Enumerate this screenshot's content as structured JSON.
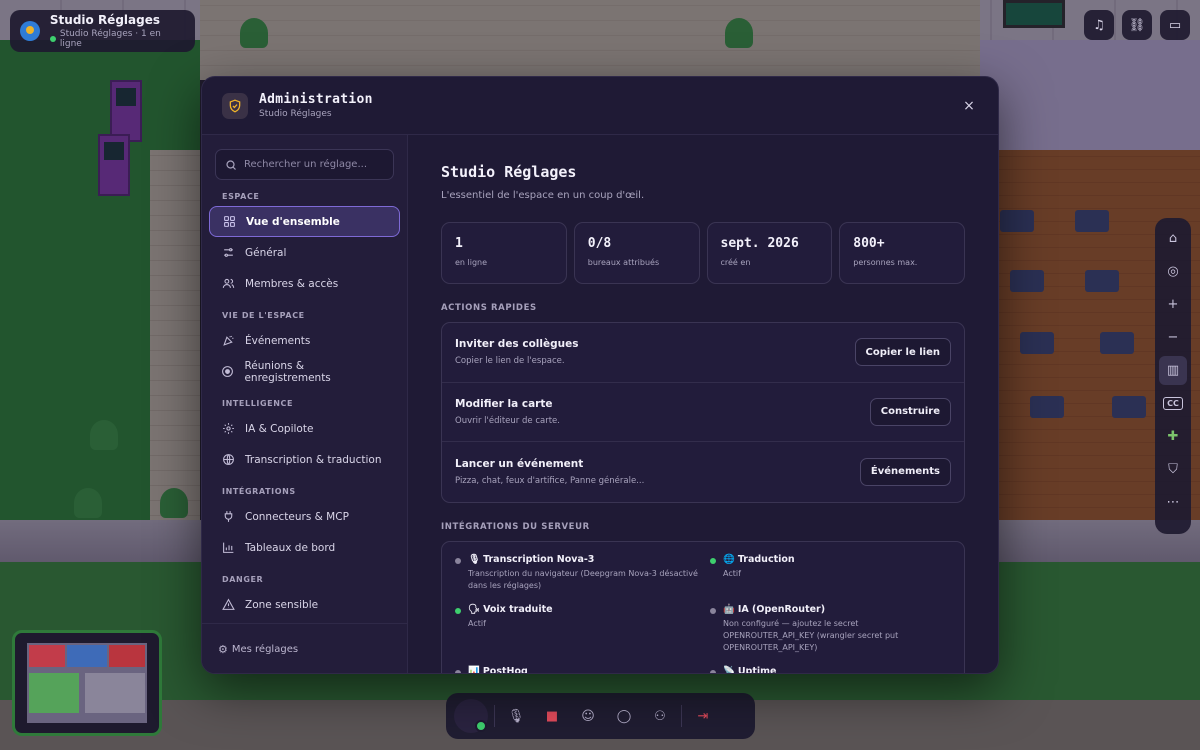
{
  "space": {
    "name": "Studio Réglages",
    "subtitle": "Studio Réglages · 1 en ligne"
  },
  "modal": {
    "title": "Administration",
    "subtitle": "Studio Réglages",
    "close_icon": "×"
  },
  "sidebar": {
    "search_placeholder": "Rechercher un réglage...",
    "sections": [
      {
        "title": "ESPACE",
        "items": [
          {
            "label": "Vue d'ensemble",
            "icon": "grid-icon",
            "active": true
          },
          {
            "label": "Général",
            "icon": "sliders-icon"
          },
          {
            "label": "Membres & accès",
            "icon": "users-icon"
          }
        ]
      },
      {
        "title": "VIE DE L'ESPACE",
        "items": [
          {
            "label": "Événements",
            "icon": "party-icon"
          },
          {
            "label": "Réunions & enregistrements",
            "icon": "record-icon"
          }
        ]
      },
      {
        "title": "INTELLIGENCE",
        "items": [
          {
            "label": "IA & Copilote",
            "icon": "gear-icon"
          },
          {
            "label": "Transcription & traduction",
            "icon": "globe-icon"
          }
        ]
      },
      {
        "title": "INTÉGRATIONS",
        "items": [
          {
            "label": "Connecteurs & MCP",
            "icon": "plug-icon"
          },
          {
            "label": "Tableaux de bord",
            "icon": "chart-icon"
          }
        ]
      },
      {
        "title": "DANGER",
        "items": [
          {
            "label": "Zone sensible",
            "icon": "warning-icon"
          }
        ]
      }
    ],
    "footer_label": "Mes réglages"
  },
  "main": {
    "title": "Studio Réglages",
    "lead": "L'essentiel de l'espace en un coup d'œil.",
    "stats": [
      {
        "value": "1",
        "label": "en ligne"
      },
      {
        "value": "0/8",
        "label": "bureaux attribués"
      },
      {
        "value": "sept. 2026",
        "label": "créé en"
      },
      {
        "value": "800+",
        "label": "personnes max."
      }
    ],
    "actions_heading": "ACTIONS RAPIDES",
    "actions": [
      {
        "title": "Inviter des collègues",
        "desc": "Copier le lien de l'espace.",
        "button": "Copier le lien"
      },
      {
        "title": "Modifier la carte",
        "desc": "Ouvrir l'éditeur de carte.",
        "button": "Construire"
      },
      {
        "title": "Lancer un événement",
        "desc": "Pizza, chat, feux d'artifice, Panne générale...",
        "button": "Événements"
      }
    ],
    "integrations_heading": "INTÉGRATIONS DU SERVEUR",
    "integrations": [
      {
        "emoji": "🎙",
        "name": "Transcription Nova-3",
        "status": "Transcription du navigateur (Deepgram Nova-3 désactivé dans les réglages)",
        "on": false
      },
      {
        "emoji": "🌐",
        "name": "Traduction",
        "status": "Actif",
        "on": true
      },
      {
        "emoji": "🗣",
        "name": "Voix traduite",
        "status": "Actif",
        "on": true
      },
      {
        "emoji": "🤖",
        "name": "IA (OpenRouter)",
        "status": "Non configuré — ajoutez le secret OPENROUTER_API_KEY (wrangler secret put OPENROUTER_API_KEY)",
        "on": false
      },
      {
        "emoji": "📊",
        "name": "PostHog",
        "status": "",
        "on": false
      },
      {
        "emoji": "📡",
        "name": "Uptime",
        "status": "",
        "on": false
      }
    ]
  },
  "colors": {
    "accent": "#7e6ad6",
    "online": "#3ecf6e",
    "modal_bg": "#1f1a35"
  }
}
